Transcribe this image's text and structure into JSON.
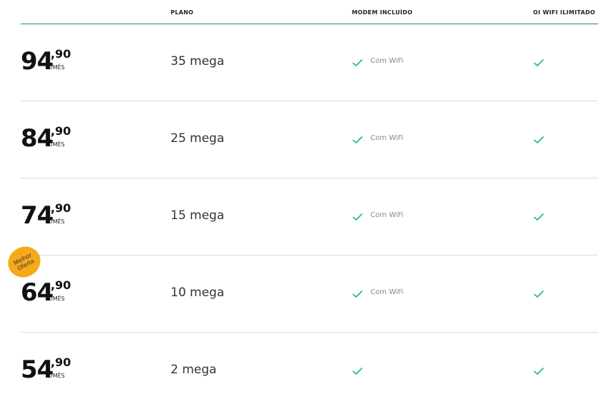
{
  "header": {
    "plano": "PLANO",
    "modem": "MODEM INCLUÍDO",
    "wifi": "OI WIFI ILIMITADO"
  },
  "badge": {
    "line1": "Melhor",
    "line2": "Oferta"
  },
  "plans": [
    {
      "price_int": "94",
      "price_dec": ",90",
      "unit": "/MÊS",
      "speed": "35 mega",
      "modem_label": "Com WiFi"
    },
    {
      "price_int": "84",
      "price_dec": ",90",
      "unit": "/MÊS",
      "speed": "25 mega",
      "modem_label": "Com WiFi"
    },
    {
      "price_int": "74",
      "price_dec": ",90",
      "unit": "/MÊS",
      "speed": "15 mega",
      "modem_label": "Com WiFi"
    },
    {
      "price_int": "64",
      "price_dec": ",90",
      "unit": "/MÊS",
      "speed": "10 mega",
      "modem_label": "Com WiFi"
    },
    {
      "price_int": "54",
      "price_dec": ",90",
      "unit": "/MÊS",
      "speed": "2 mega",
      "modem_label": ""
    }
  ],
  "colors": {
    "check": "#2bb3a6",
    "badge": "#f7a81b",
    "header_rule": "#2a7f7f"
  },
  "icons": {
    "check": "check-icon"
  }
}
